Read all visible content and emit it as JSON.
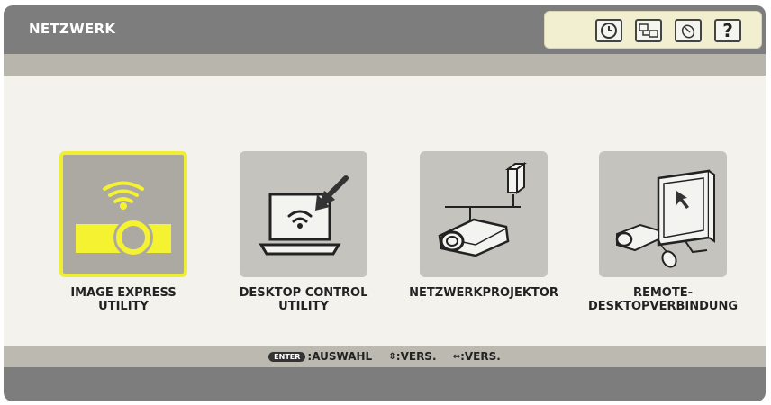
{
  "header": {
    "title": "NETZWERK",
    "icons": [
      "clock-icon",
      "network-settings-icon",
      "mouse-icon",
      "help-icon"
    ],
    "help_glyph": "?"
  },
  "menu": {
    "items": [
      {
        "label": "IMAGE EXPRESS\nUTILITY",
        "icon": "wireless-projector-icon",
        "selected": true
      },
      {
        "label": "DESKTOP CONTROL\nUTILITY",
        "icon": "laptop-wireless-icon",
        "selected": false
      },
      {
        "label": "NETZWERKPROJEKTOR",
        "icon": "network-projector-icon",
        "selected": false
      },
      {
        "label": "REMOTE-\nDESKTOPVERBINDUNG",
        "icon": "remote-desktop-icon",
        "selected": false
      }
    ]
  },
  "footer": {
    "enter_key": "ENTER",
    "select_text": ":AUSWAHL",
    "updown_text": ":VERS.",
    "leftright_text": ":VERS."
  },
  "colors": {
    "header_bg": "#7d7d7d",
    "selected_border": "#f0ee30",
    "selected_icon": "#f4f231",
    "tile_bg": "#c5c3bd"
  }
}
